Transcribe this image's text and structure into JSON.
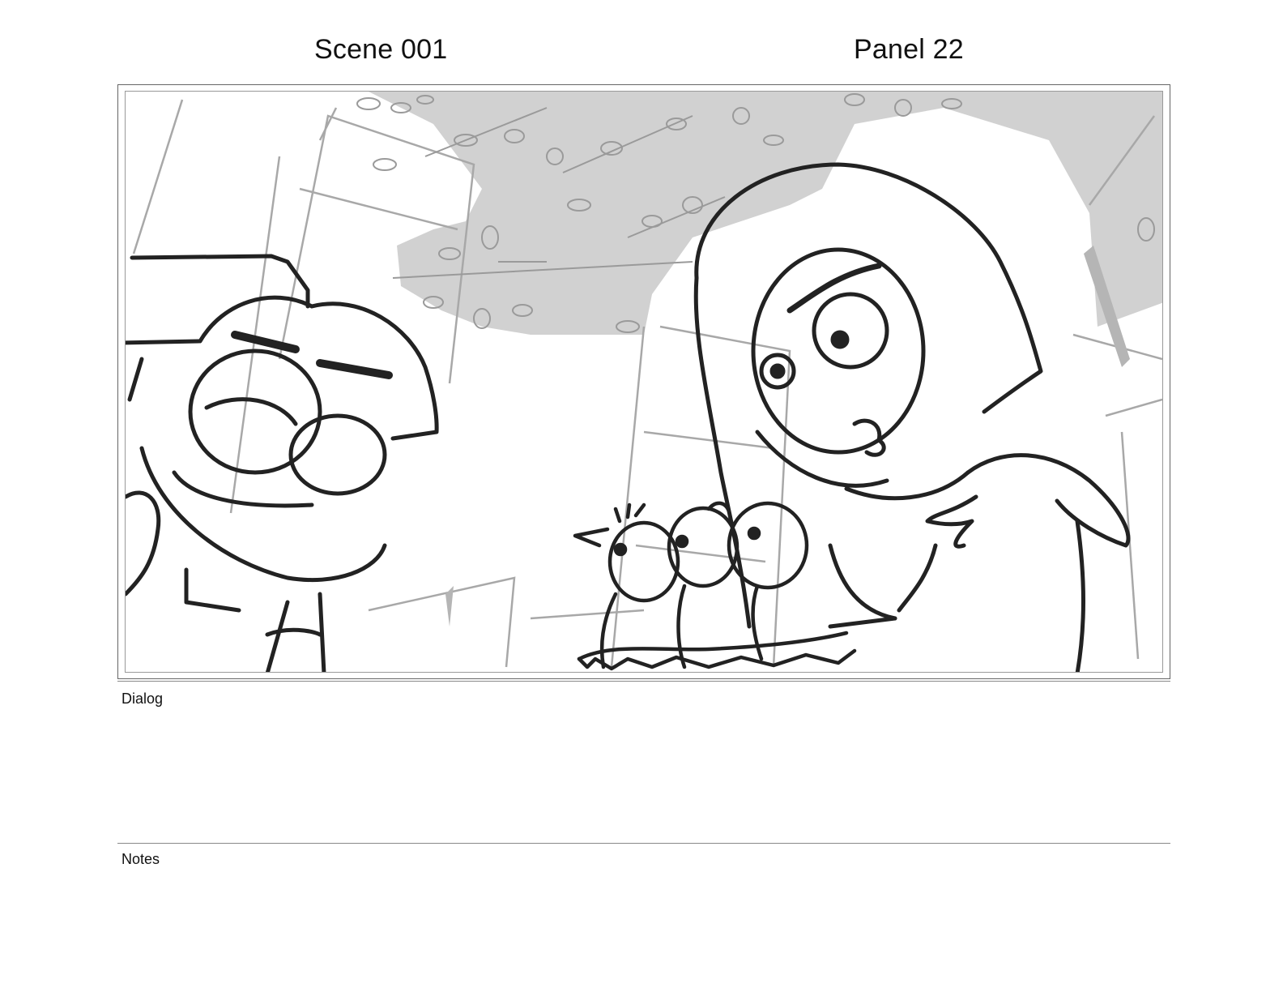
{
  "header": {
    "scene": "Scene 001",
    "panel": "Panel 22"
  },
  "sections": {
    "dialog_label": "Dialog",
    "dialog_text": "",
    "notes_label": "Notes",
    "notes_text": ""
  },
  "colors": {
    "line": "#222222",
    "foliage_fill": "#cfcfcf",
    "sketch_gray": "#a8a8a8",
    "frame_border": "#666666"
  },
  "icons": {
    "panel_art": "storyboard-sketch-illustration"
  }
}
